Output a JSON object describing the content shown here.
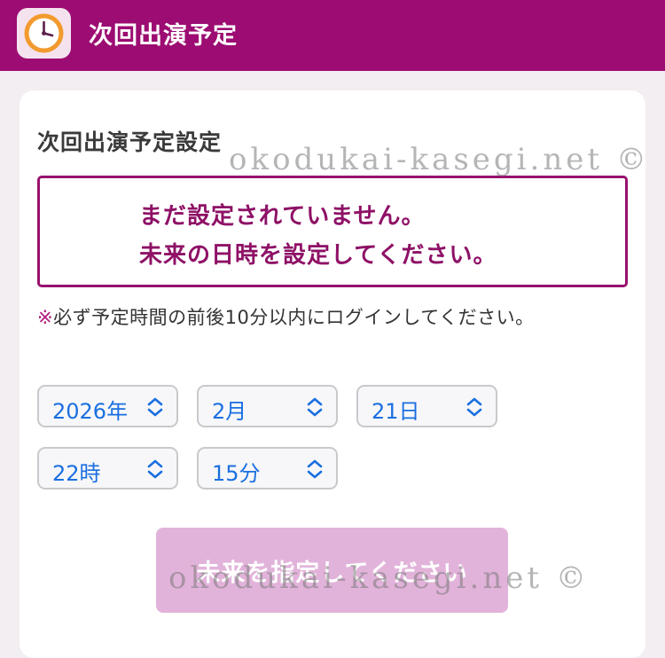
{
  "header": {
    "title": "次回出演予定",
    "icon": "clock-icon"
  },
  "section": {
    "title": "次回出演予定設定"
  },
  "alert": {
    "line1": "まだ設定されていません。",
    "line2": "未来の日時を設定してください。"
  },
  "note": {
    "mark": "※",
    "text": "必ず予定時間の前後10分以内にログインしてください。"
  },
  "selects": {
    "year": "2026年",
    "month": "2月",
    "day": "21日",
    "hour": "22時",
    "minute": "15分"
  },
  "submit": {
    "label": "未来を指定してください"
  },
  "watermark": {
    "text": "okodukai-kasegi.net ©"
  },
  "colors": {
    "header_bg": "#9c0c72",
    "alert_border": "#98116e",
    "alert_text": "#8e1166",
    "select_text": "#1a6fe0",
    "button_disabled": "#e2b3da"
  }
}
